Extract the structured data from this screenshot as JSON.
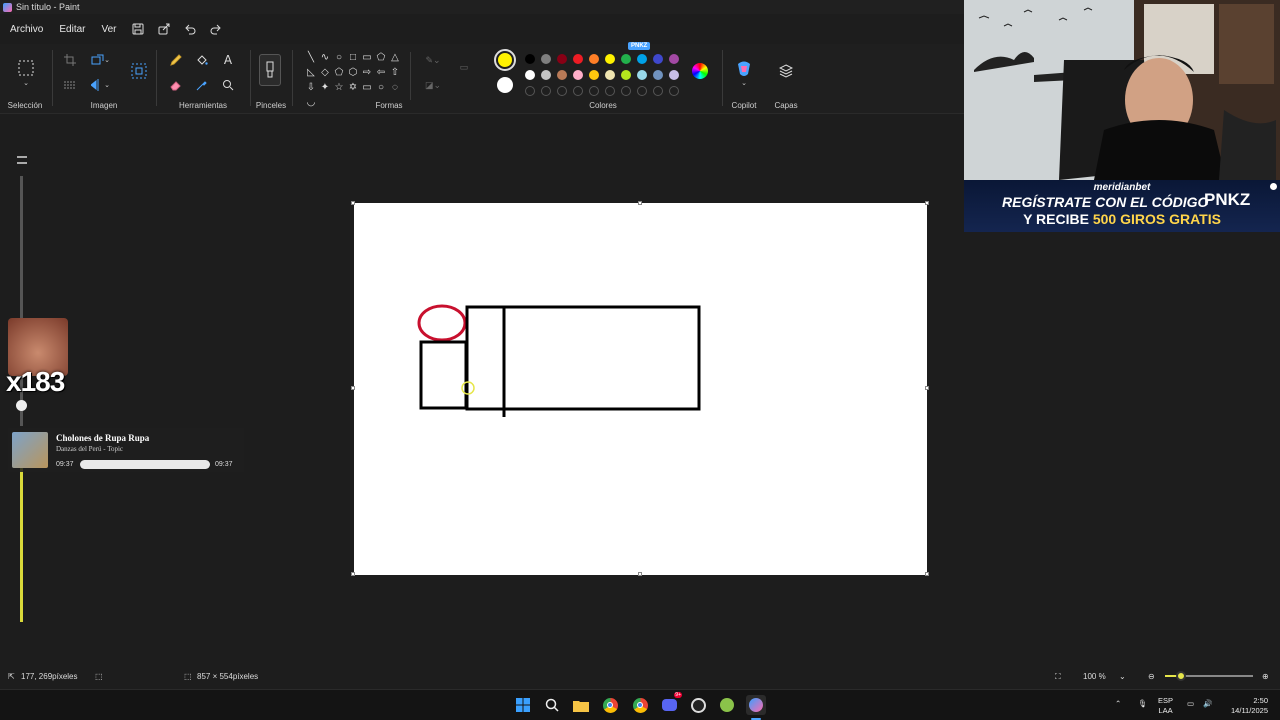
{
  "window": {
    "title": "Sin título - Paint"
  },
  "menu": {
    "file": "Archivo",
    "edit": "Editar",
    "view": "Ver"
  },
  "ribbon": {
    "groups": {
      "selection": "Selección",
      "image": "Imagen",
      "tools": "Herramientas",
      "brushes": "Pinceles",
      "shapes": "Formas",
      "colors": "Colores",
      "copilot": "Copilot",
      "layers": "Capas"
    },
    "shape_glyphs": [
      "╲",
      "∿",
      "○",
      "□",
      "▭",
      "⬠",
      "△",
      "◺",
      "◇",
      "⬠",
      "⬡",
      "⇨",
      "⇦",
      "⇧",
      "⇩",
      "✦",
      "☆",
      "✡",
      "▭",
      "○",
      "◌",
      "◡"
    ],
    "palette_row1": [
      "#000000",
      "#7f7f7f",
      "#880015",
      "#ed1c24",
      "#ff7f27",
      "#fff200",
      "#22b14c",
      "#00a2e8",
      "#3f48cc",
      "#a349a4"
    ],
    "palette_row2": [
      "#ffffff",
      "#c3c3c3",
      "#b97a57",
      "#ffaec9",
      "#ffc90e",
      "#efe4b0",
      "#b5e61d",
      "#99d9ea",
      "#7092be",
      "#c8bfe7"
    ],
    "primary_color": "#fff200",
    "secondary_color": "#ffffff",
    "pnkz_tag": "PNKZ"
  },
  "overlay": {
    "emote_count": "x183",
    "music": {
      "title": "Cholones de Rupa Rupa",
      "artist": "Danzas del Perú - Topic",
      "elapsed": "09:37",
      "total": "09:37",
      "progress": 1.0
    }
  },
  "ad": {
    "brand": "meridianbet",
    "line1": "REGÍSTRATE CON EL CÓDIGO",
    "code": "PNKZ",
    "line2_prefix": "Y RECIBE ",
    "line2_highlight": "500 GIROS GRATIS"
  },
  "status": {
    "cursor_pos": "177, 269píxeles",
    "canvas_size": "857 × 554píxeles",
    "zoom": "100 %"
  },
  "taskbar": {
    "lang": "ESP",
    "lang_sub": "LAA",
    "time": "2:50",
    "date": "14/11/2025",
    "discord_badge": "9+"
  }
}
